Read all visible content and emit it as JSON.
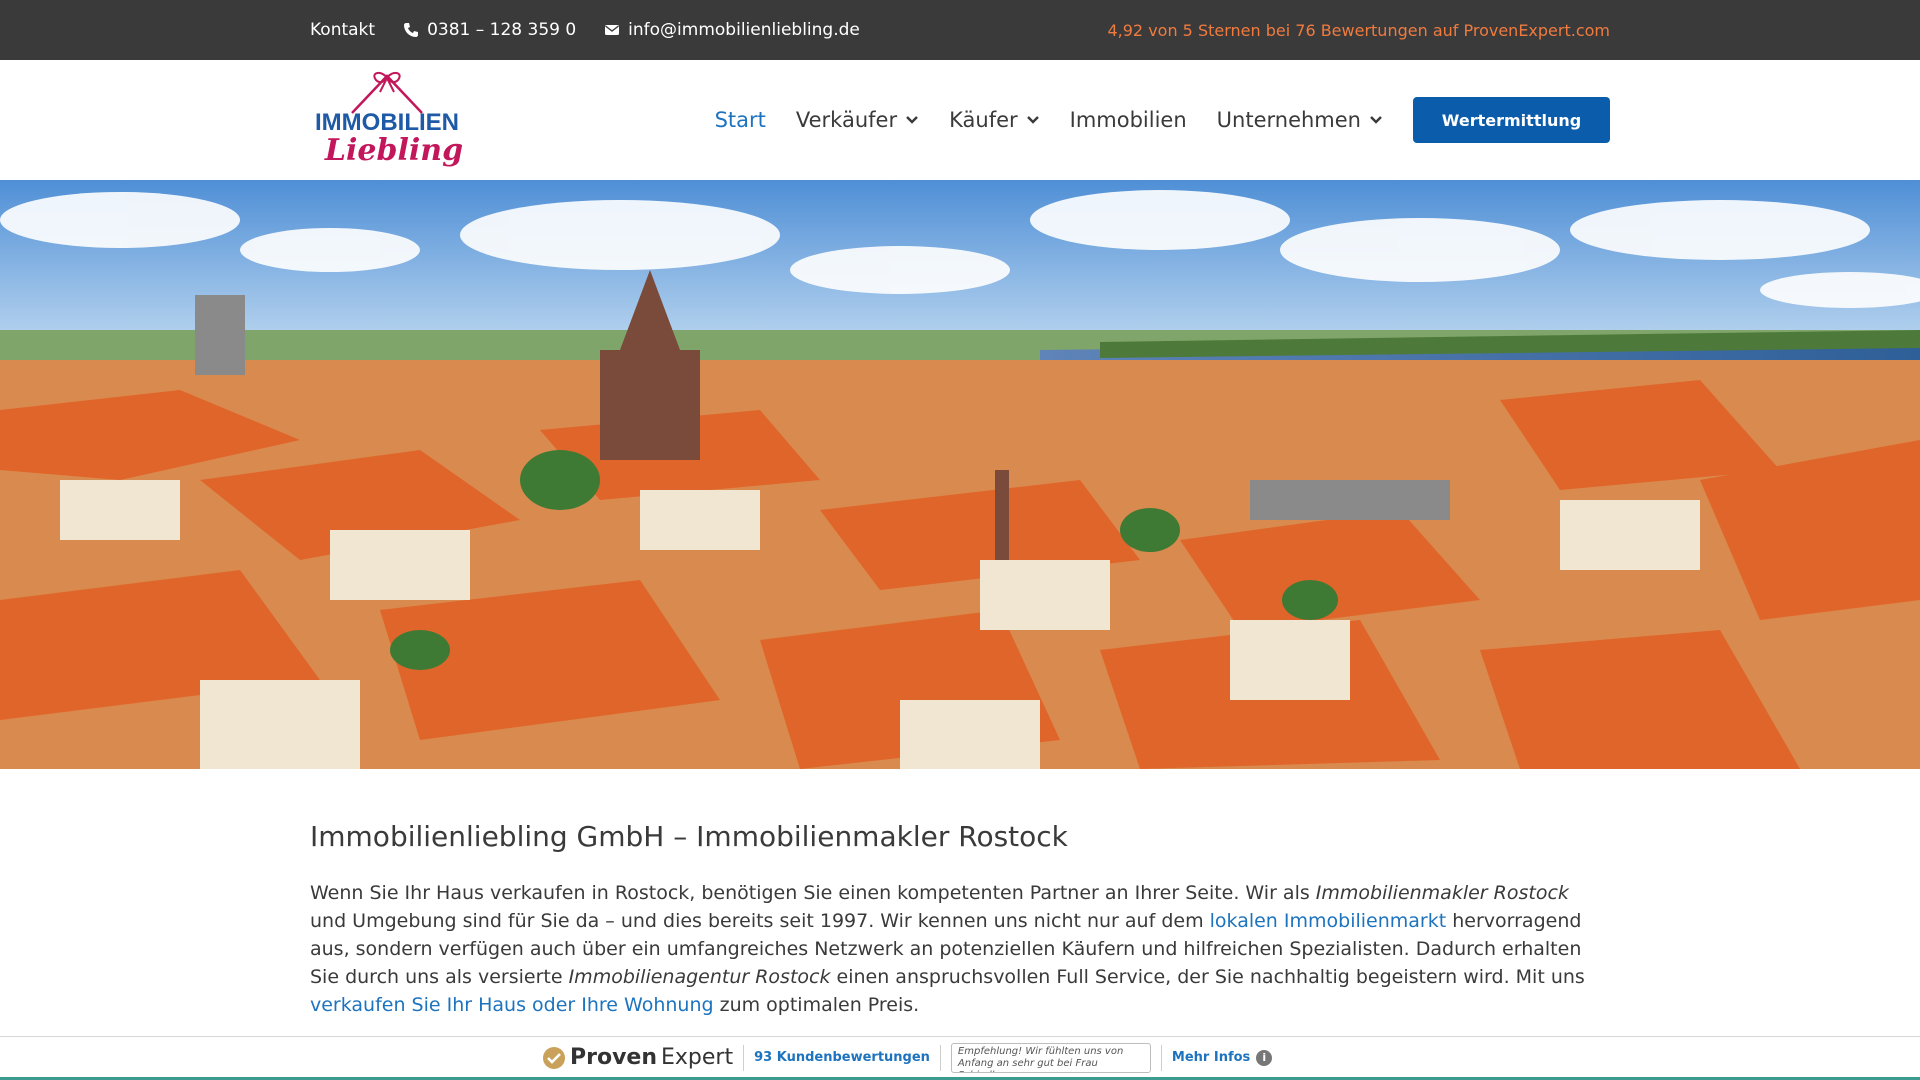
{
  "topbar": {
    "contact_label": "Kontakt",
    "phone": "0381 – 128 359 0",
    "email": "info@immobilienliebling.de",
    "rating_text": "4,92 von 5 Sternen bei 76 Bewertungen auf ProvenExpert.com"
  },
  "header": {
    "logo_text_top": "IMMOBILIEN",
    "logo_text_bottom": "Liebling",
    "nav": [
      {
        "label": "Start",
        "active": true,
        "has_dropdown": false
      },
      {
        "label": "Verkäufer",
        "active": false,
        "has_dropdown": true
      },
      {
        "label": "Käufer",
        "active": false,
        "has_dropdown": true
      },
      {
        "label": "Immobilien",
        "active": false,
        "has_dropdown": false
      },
      {
        "label": "Unternehmen",
        "active": false,
        "has_dropdown": true
      }
    ],
    "cta_label": "Wertermittlung"
  },
  "hero": {
    "icon": "rostock-cityscape-image"
  },
  "main": {
    "heading": "Immobilienliebling GmbH – Immobilienmakler Rostock",
    "p1": "Wenn Sie Ihr Haus verkaufen in Rostock, benötigen Sie einen kompetenten Partner an Ihrer Seite. Wir als ",
    "p1_em": "Immobilienmakler Rostock",
    "p2": " und Umgebung sind für Sie da – und dies bereits seit 1997. Wir kennen uns nicht nur auf dem ",
    "link1": "lokalen Immobilienmarkt",
    "p3": " hervorragend aus, sondern verfügen auch über ein umfangreiches Netzwerk an potenziellen Käufern und hilfreichen Spezialisten. Dadurch erhalten Sie durch uns als versierte ",
    "p3_em": "Immobilienagentur Rostock",
    "p4": " einen anspruchsvollen Full Service, der Sie nachhaltig begeistern wird. Mit uns ",
    "link2": "verkaufen Sie Ihr Haus oder Ihre Wohnung",
    "p5": " zum optimalen Preis."
  },
  "provenexpert": {
    "brand_a": "Proven",
    "brand_b": "Expert",
    "reviews": "93 Kundenbewertungen",
    "quote": "Empfehlung! Wir fühlten uns von Anfang an sehr gut bei Frau Schindl...",
    "more": "Mehr Infos",
    "info_glyph": "i"
  },
  "colors": {
    "topbar_bg": "#3a3a3a",
    "rating": "#f07b3f",
    "link": "#1e73be",
    "cta_bg": "#0b5cab",
    "logo_blue": "#1f5aa6",
    "logo_pink": "#c2185b"
  }
}
